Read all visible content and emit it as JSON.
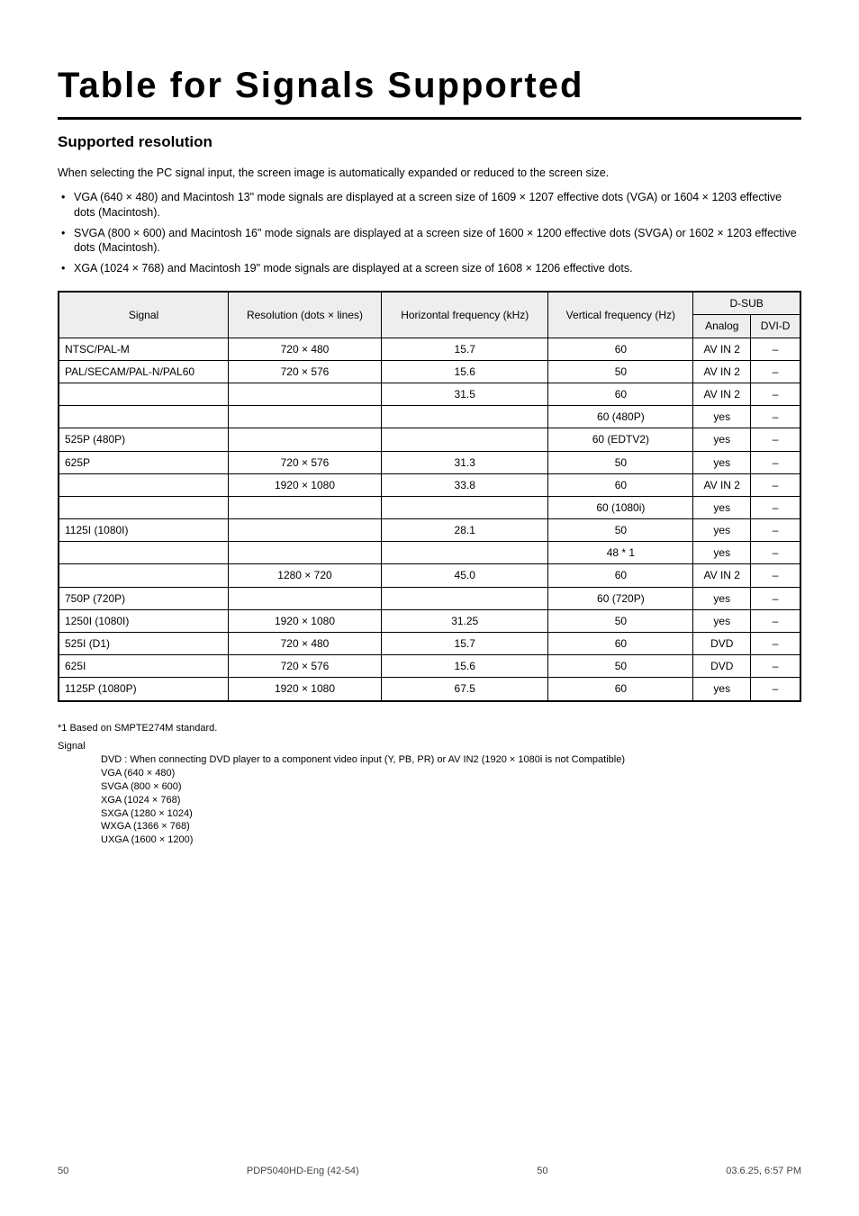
{
  "title": "Table for Signals Supported",
  "subtitle": "Supported resolution",
  "desc": "When selecting the PC signal input, the screen image is automatically expanded or reduced to the screen size.",
  "bullets": [
    "VGA (640 × 480) and Macintosh 13\" mode signals are displayed at a screen size of 1609 × 1207 effective dots (VGA) or 1604 × 1203 effective dots (Macintosh).",
    "SVGA (800 × 600) and Macintosh 16\" mode signals are displayed at a screen size of 1600 × 1200 effective dots (SVGA) or 1602 × 1203 effective dots (Macintosh).",
    "XGA (1024 × 768) and Macintosh 19\" mode signals are displayed at a screen size of 1608 × 1206 effective dots."
  ],
  "table": {
    "head": {
      "c1": "Signal",
      "c2": "Resolution (dots × lines)",
      "c3": "Horizontal frequency (kHz)",
      "c4": "Vertical frequency (Hz)",
      "c5": "D-SUB",
      "c5a": "Analog",
      "c5b": "DVI-D"
    },
    "rows": [
      {
        "c1": "NTSC/PAL-M",
        "c2": "720 × 480",
        "c3": "15.7",
        "c4": "60",
        "c5a": "AV IN 2",
        "c5b": "–"
      },
      {
        "c1": "PAL/SECAM/PAL-N/PAL60",
        "c2": "720 × 576",
        "c3": "15.6",
        "c4": "50",
        "c5a": "AV IN 2",
        "c5b": "–"
      },
      {
        "c1": "",
        "c2": "",
        "c3": "31.5",
        "c4": "60",
        "c5a": "AV IN 2",
        "c5b": "–"
      },
      {
        "c1": "",
        "c2": "",
        "c3": "",
        "c4": "60 (480P)",
        "c5a": "yes",
        "c5b": "–"
      },
      {
        "c1": "525P (480P)",
        "c2": "",
        "c3": "",
        "c4": "60 (EDTV2)",
        "c5a": "yes",
        "c5b": "–"
      },
      {
        "c1": "625P",
        "c2": "720 × 576",
        "c3": "31.3",
        "c4": "50",
        "c5a": "yes",
        "c5b": "–"
      },
      {
        "c1": "",
        "c2": "1920 × 1080",
        "c3": "33.8",
        "c4": "60",
        "c5a": "AV IN 2",
        "c5b": "–"
      },
      {
        "c1": "",
        "c2": "",
        "c3": "",
        "c4": "60 (1080i)",
        "c5a": "yes",
        "c5b": "–"
      },
      {
        "c1": "1125I (1080I)",
        "c2": "",
        "c3": "28.1",
        "c4": "50",
        "c5a": "yes",
        "c5b": "–"
      },
      {
        "c1": "",
        "c2": "",
        "c3": "",
        "c4": "48 * 1",
        "c5a": "yes",
        "c5b": "–"
      },
      {
        "c1": "",
        "c2": "1280 × 720",
        "c3": "45.0",
        "c4": "60",
        "c5a": "AV IN 2",
        "c5b": "–"
      },
      {
        "c1": "750P (720P)",
        "c2": "",
        "c3": "",
        "c4": "60 (720P)",
        "c5a": "yes",
        "c5b": "–"
      },
      {
        "c1": "1250I (1080I)",
        "c2": "1920 × 1080",
        "c3": "31.25",
        "c4": "50",
        "c5a": "yes",
        "c5b": "–"
      },
      {
        "c1": "525I (D1)",
        "c2": "720 × 480",
        "c3": "15.7",
        "c4": "60",
        "c5a": "DVD",
        "c5b": "–"
      },
      {
        "c1": "625I",
        "c2": "720 × 576",
        "c3": "15.6",
        "c4": "50",
        "c5a": "DVD",
        "c5b": "–"
      },
      {
        "c1": "1125P (1080P)",
        "c2": "1920 × 1080",
        "c3": "67.5",
        "c4": "60",
        "c5a": "yes",
        "c5b": "–"
      }
    ]
  },
  "notes": {
    "header": "*1   Based on SMPTE274M standard.",
    "s_head": "Signal",
    "s_lines": [
      "DVD   :   When connecting DVD player to a component video input (Y, PB, PR) or AV IN2 (1920 × 1080i is not Compatible)",
      "VGA (640 × 480)",
      "SVGA (800 × 600)",
      "XGA (1024 × 768)",
      "SXGA (1280 × 1024)",
      "WXGA (1366 × 768)",
      "UXGA (1600 × 1200)"
    ]
  },
  "footer_left": "50",
  "footer_right": "PDP5040HD-Eng (42-54)",
  "footer_page": "50",
  "footer_date": "03.6.25, 6:57 PM"
}
